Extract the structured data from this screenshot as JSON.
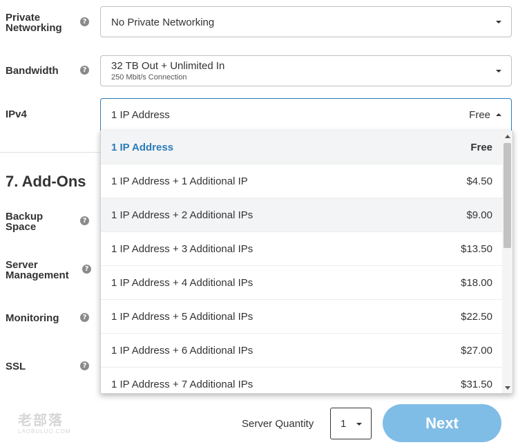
{
  "fields": {
    "private_networking": {
      "label_line1": "Private",
      "label_line2": "Networking",
      "value": "No Private Networking"
    },
    "bandwidth": {
      "label": "Bandwidth",
      "value": "32 TB Out + Unlimited In",
      "subvalue": "250 Mbit/s Connection"
    },
    "ipv4": {
      "label": "IPv4",
      "value": "1 IP Address",
      "price": "Free"
    }
  },
  "help_glyph": "?",
  "addons": {
    "title": "7. Add-Ons",
    "backup_line1": "Backup",
    "backup_line2": "Space",
    "mgmt_line1": "Server",
    "mgmt_line2": "Management",
    "monitoring": "Monitoring",
    "ssl": "SSL"
  },
  "ipv4_options": [
    {
      "name": "1 IP Address",
      "price": "Free"
    },
    {
      "name": "1 IP Address + 1 Additional IP",
      "price": "$4.50"
    },
    {
      "name": "1 IP Address + 2 Additional IPs",
      "price": "$9.00"
    },
    {
      "name": "1 IP Address + 3 Additional IPs",
      "price": "$13.50"
    },
    {
      "name": "1 IP Address + 4 Additional IPs",
      "price": "$18.00"
    },
    {
      "name": "1 IP Address + 5 Additional IPs",
      "price": "$22.50"
    },
    {
      "name": "1 IP Address + 6 Additional IPs",
      "price": "$27.00"
    },
    {
      "name": "1 IP Address + 7 Additional IPs",
      "price": "$31.50"
    }
  ],
  "footer": {
    "logo_main": "老部落",
    "logo_sub": "LAOBULUO.COM",
    "quantity_label": "Server Quantity",
    "quantity_value": "1",
    "next_label": "Next"
  },
  "colors": {
    "accent": "#2b7bb9",
    "next_button": "#80bde6"
  }
}
